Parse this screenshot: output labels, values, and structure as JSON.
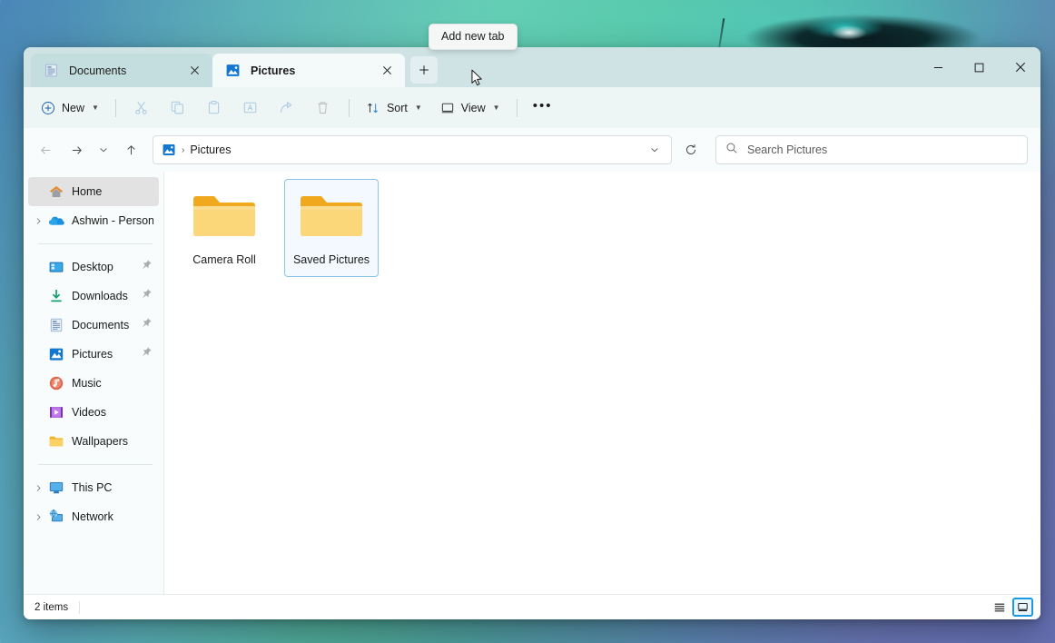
{
  "tooltip": {
    "text": "Add new tab"
  },
  "titlebar": {
    "tabs": [
      {
        "label": "Documents",
        "icon": "documents-icon",
        "active": false
      },
      {
        "label": "Pictures",
        "icon": "pictures-icon",
        "active": true
      }
    ],
    "new_tab_label": "+",
    "controls": {
      "minimize": "—",
      "maximize": "□",
      "close": "✕"
    }
  },
  "commandbar": {
    "new_label": "New",
    "sort_label": "Sort",
    "view_label": "View",
    "more_label": "•••",
    "icons": [
      {
        "name": "cut-icon",
        "disabled": true
      },
      {
        "name": "copy-icon",
        "disabled": true
      },
      {
        "name": "paste-icon",
        "disabled": true
      },
      {
        "name": "rename-icon",
        "disabled": true
      },
      {
        "name": "share-icon",
        "disabled": true
      },
      {
        "name": "delete-icon",
        "disabled": true
      }
    ]
  },
  "addressbar": {
    "back_disabled": true,
    "breadcrumb_icon": "pictures-icon",
    "breadcrumb_separator": "›",
    "path": "Pictures",
    "search_placeholder": "Search Pictures",
    "search_value": ""
  },
  "sidebar": {
    "items": [
      {
        "label": "Home",
        "icon": "home-icon",
        "selected": true,
        "expandable": false,
        "pinned": false
      },
      {
        "label": "Ashwin - Personal",
        "icon": "onedrive-icon",
        "selected": false,
        "expandable": true,
        "pinned": false
      },
      {
        "divider": true
      },
      {
        "label": "Desktop",
        "icon": "desktop-icon",
        "selected": false,
        "expandable": false,
        "pinned": true
      },
      {
        "label": "Downloads",
        "icon": "downloads-icon",
        "selected": false,
        "expandable": false,
        "pinned": true
      },
      {
        "label": "Documents",
        "icon": "documents-icon",
        "selected": false,
        "expandable": false,
        "pinned": true
      },
      {
        "label": "Pictures",
        "icon": "pictures-icon",
        "selected": false,
        "expandable": false,
        "pinned": true
      },
      {
        "label": "Music",
        "icon": "music-icon",
        "selected": false,
        "expandable": false,
        "pinned": false
      },
      {
        "label": "Videos",
        "icon": "videos-icon",
        "selected": false,
        "expandable": false,
        "pinned": false
      },
      {
        "label": "Wallpapers",
        "icon": "folder-icon",
        "selected": false,
        "expandable": false,
        "pinned": false
      },
      {
        "divider": true
      },
      {
        "label": "This PC",
        "icon": "thispc-icon",
        "selected": false,
        "expandable": true,
        "pinned": false
      },
      {
        "label": "Network",
        "icon": "network-icon",
        "selected": false,
        "expandable": true,
        "pinned": false
      }
    ]
  },
  "content": {
    "items": [
      {
        "name": "Camera Roll",
        "icon": "folder-icon",
        "selected": false
      },
      {
        "name": "Saved Pictures",
        "icon": "folder-icon",
        "selected": true
      }
    ]
  },
  "statusbar": {
    "items_text": "2 items",
    "view_list_label": "list-view",
    "view_details_label": "large-icons-view"
  },
  "colors": {
    "accent": "#0a6cbe",
    "titlebar_bg": "#cfe3e5",
    "active_tab_bg": "#f4f9f9",
    "commandbar_bg": "#eef5f5",
    "selection_border": "#8ec3e8",
    "selection_bg": "#f3f9fe",
    "toggle_active": "#1a9ae0"
  }
}
